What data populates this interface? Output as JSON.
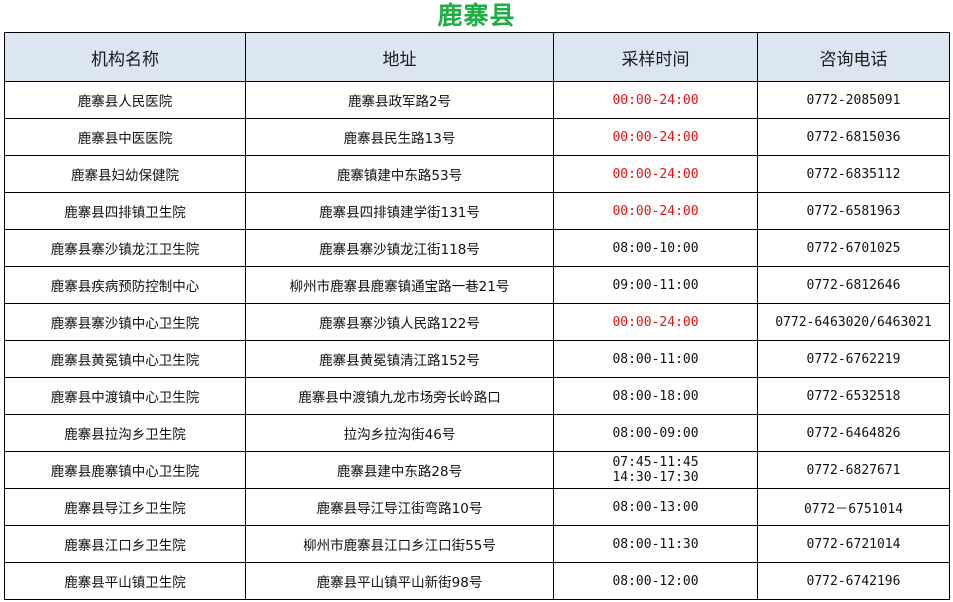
{
  "title": "鹿寨县",
  "colors": {
    "title": "#1fae45",
    "header_bg": "#dce6f2",
    "open_all_day": "#e01414"
  },
  "headers": [
    "机构名称",
    "地址",
    "采样时间",
    "咨询电话"
  ],
  "rows": [
    {
      "name": "鹿寨县人民医院",
      "address": "鹿寨县政军路2号",
      "time": [
        "00:00-24:00"
      ],
      "red": true,
      "phone": "0772-2085091"
    },
    {
      "name": "鹿寨县中医医院",
      "address": "鹿寨县民生路13号",
      "time": [
        "00:00-24:00"
      ],
      "red": true,
      "phone": "0772-6815036"
    },
    {
      "name": "鹿寨县妇幼保健院",
      "address": "鹿寨镇建中东路53号",
      "time": [
        "00:00-24:00"
      ],
      "red": true,
      "phone": "0772-6835112"
    },
    {
      "name": "鹿寨县四排镇卫生院",
      "address": "鹿寨县四排镇建学街131号",
      "time": [
        "00:00-24:00"
      ],
      "red": true,
      "phone": "0772-6581963"
    },
    {
      "name": "鹿寨县寨沙镇龙江卫生院",
      "address": "鹿寨县寨沙镇龙江街118号",
      "time": [
        "08:00-10:00"
      ],
      "red": false,
      "phone": "0772-6701025"
    },
    {
      "name": "鹿寨县疾病预防控制中心",
      "address": "柳州市鹿寨县鹿寨镇通宝路一巷21号",
      "time": [
        "09:00-11:00"
      ],
      "red": false,
      "phone": "0772-6812646"
    },
    {
      "name": "鹿寨县寨沙镇中心卫生院",
      "address": "鹿寨县寨沙镇人民路122号",
      "time": [
        "00:00-24:00"
      ],
      "red": true,
      "phone": "0772-6463020/6463021"
    },
    {
      "name": "鹿寨县黄冕镇中心卫生院",
      "address": "鹿寨县黄冕镇清江路152号",
      "time": [
        "08:00-11:00"
      ],
      "red": false,
      "phone": "0772-6762219"
    },
    {
      "name": "鹿寨县中渡镇中心卫生院",
      "address": "鹿寨县中渡镇九龙市场旁长岭路口",
      "time": [
        "08:00-18:00"
      ],
      "red": false,
      "phone": "0772-6532518"
    },
    {
      "name": "鹿寨县拉沟乡卫生院",
      "address": "拉沟乡拉沟街46号",
      "time": [
        "08:00-09:00"
      ],
      "red": false,
      "phone": "0772-6464826"
    },
    {
      "name": "鹿寨县鹿寨镇中心卫生院",
      "address": "鹿寨县建中东路28号",
      "time": [
        "07:45-11:45",
        "14:30-17:30"
      ],
      "red": false,
      "phone": "0772-6827671"
    },
    {
      "name": "鹿寨县导江乡卫生院",
      "address": "鹿寨县导江导江街弯路10号",
      "time": [
        "08:00-13:00"
      ],
      "red": false,
      "phone": "0772－6751014"
    },
    {
      "name": "鹿寨县江口乡卫生院",
      "address": "柳州市鹿寨县江口乡江口街55号",
      "time": [
        "08:00-11:30"
      ],
      "red": false,
      "phone": "0772-6721014"
    },
    {
      "name": "鹿寨县平山镇卫生院",
      "address": "鹿寨县平山镇平山新街98号",
      "time": [
        "08:00-12:00"
      ],
      "red": false,
      "phone": "0772-6742196"
    }
  ]
}
